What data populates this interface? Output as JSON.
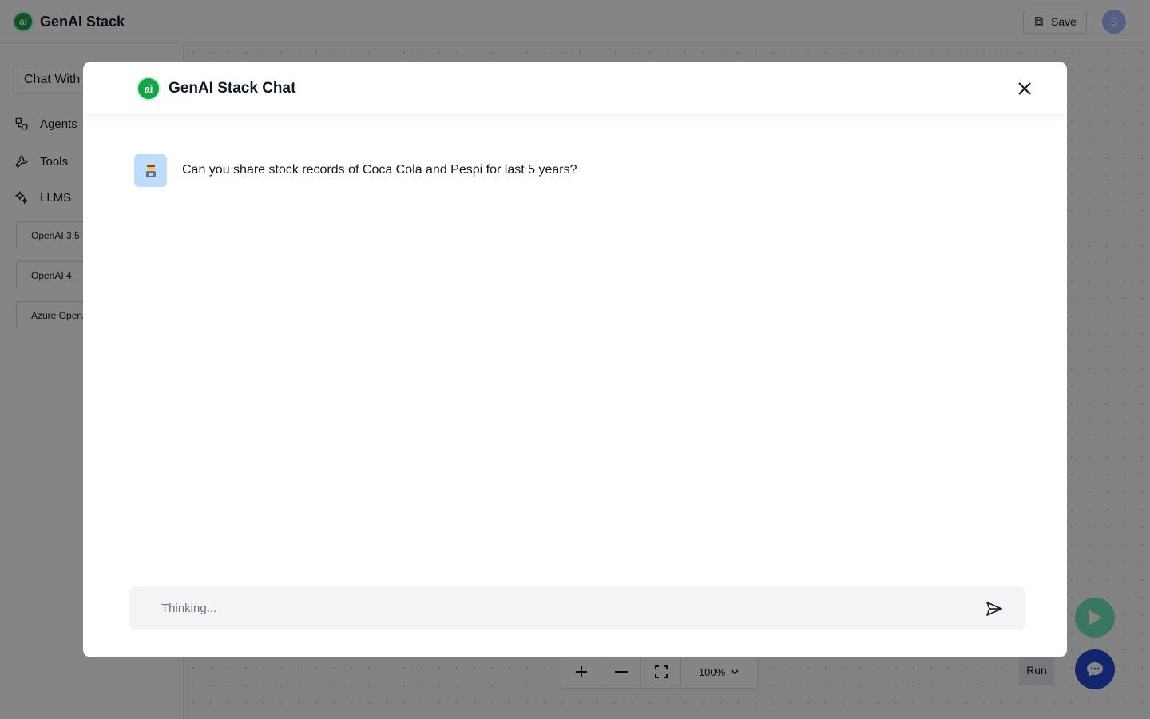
{
  "app": {
    "title": "GenAI Stack",
    "logo_text": "ai",
    "save_label": "Save",
    "avatar_initial": "S"
  },
  "sidebar": {
    "chat_with_label": "Chat With",
    "sections": [
      {
        "label": "Agents",
        "icon": "agents-icon"
      },
      {
        "label": "Tools",
        "icon": "wrench-icon"
      },
      {
        "label": "LLMS",
        "icon": "sparkles-icon"
      }
    ],
    "llm_cards": [
      "OpenAI 3.5",
      "OpenAI 4",
      "Azure OpenAI"
    ]
  },
  "canvas": {
    "zoom_level": "100%",
    "run_tooltip": "Run"
  },
  "modal": {
    "title": "GenAI Stack Chat",
    "logo_text": "ai",
    "messages": [
      {
        "sender": "user",
        "text": "Can you share stock records of Coca Cola and Pespi for last 5 years?"
      }
    ],
    "input_placeholder": "Thinking..."
  },
  "colors": {
    "brand_green": "#16a34a",
    "chat_fab_blue": "#2547d0",
    "run_green": "#6ee7b7",
    "user_avatar_bg": "#bfdbfe"
  }
}
